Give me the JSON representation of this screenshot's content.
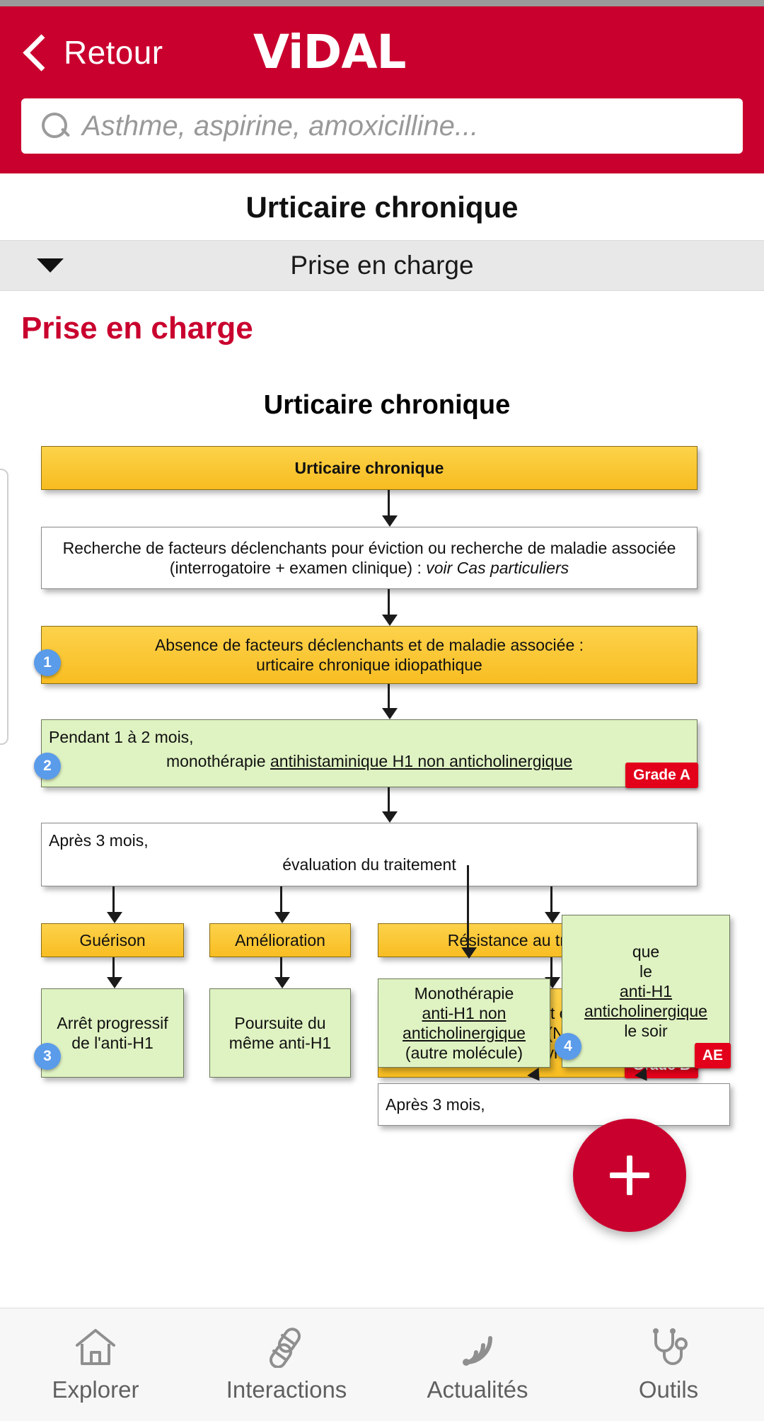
{
  "header": {
    "back_label": "Retour",
    "brand": "ViDAL",
    "back_icon": "chevron-left-icon"
  },
  "search": {
    "placeholder": "Asthme, aspirine, amoxicilline...",
    "value": "",
    "icon": "search-icon"
  },
  "page": {
    "title": "Urticaire chronique",
    "accordion_label": "Prise en charge",
    "section_heading": "Prise en charge",
    "accent_color": "#c9002e"
  },
  "diagram": {
    "title": "Urticaire chronique",
    "nodes": {
      "n1": "Urticaire chronique",
      "n2_line1": "Recherche de facteurs déclenchants pour éviction ou recherche de maladie associée",
      "n2_line2a": "(interrogatoire + examen clinique) : ",
      "n2_line2b": "voir Cas particuliers",
      "n3_line1": "Absence de facteurs déclenchants et de maladie associée :",
      "n3_line2": "urticaire chronique idiopathique",
      "n3_badge": "1",
      "n4_line1": "Pendant 1 à 2 mois,",
      "n4_line2a": "monothérapie ",
      "n4_line2b": "antihistaminique H1 non anticholinergique",
      "n4_badge": "2",
      "n4_grade": "Grade A",
      "n5_line1": "Après 3 mois,",
      "n5_line2": "évaluation du traitement",
      "n6": "Guérison",
      "n7": "Amélioration",
      "n8": "Résistance au traitement",
      "n9_line1": "Arrêt progressif",
      "n9_line2": "de l'anti-H1",
      "n9_badge": "3",
      "n10_line1": "Poursuite du",
      "n10_line2": "même anti-H1",
      "n11_line1": "Après interrogatoire et examen clinique,",
      "n11_line2": "bilan paraclinique (NFS, VS, CRP",
      "n11_line3": "et anticorps antithyroperoxydase)",
      "n11_grade": "Grade B",
      "n12_line1": "Monothérapie",
      "n12_line2": "anti-H1 non",
      "n12_line3": "anticholinergique",
      "n12_line4": "(autre molécule)",
      "n13_line1": "que",
      "n13_line2": "le",
      "n13_line3": "anti-H1",
      "n13_line4": "anticholinergique",
      "n13_line5": "le soir",
      "n13_badge": "4",
      "n13_grade": "AE",
      "n14": "Après 3 mois,"
    },
    "colors": {
      "orange": "#f8bd22",
      "green": "#dff2c2",
      "white": "#ffffff",
      "badge_blue": "#5a9bea",
      "grade_red": "#e2001a"
    }
  },
  "fab": {
    "label": "+",
    "icon": "plus-icon",
    "color": "#c9002e"
  },
  "bottom_nav": {
    "items": [
      {
        "label": "Explorer",
        "icon": "home-icon"
      },
      {
        "label": "Interactions",
        "icon": "pills-icon"
      },
      {
        "label": "Actualités",
        "icon": "rss-icon"
      },
      {
        "label": "Outils",
        "icon": "stethoscope-icon"
      }
    ]
  }
}
